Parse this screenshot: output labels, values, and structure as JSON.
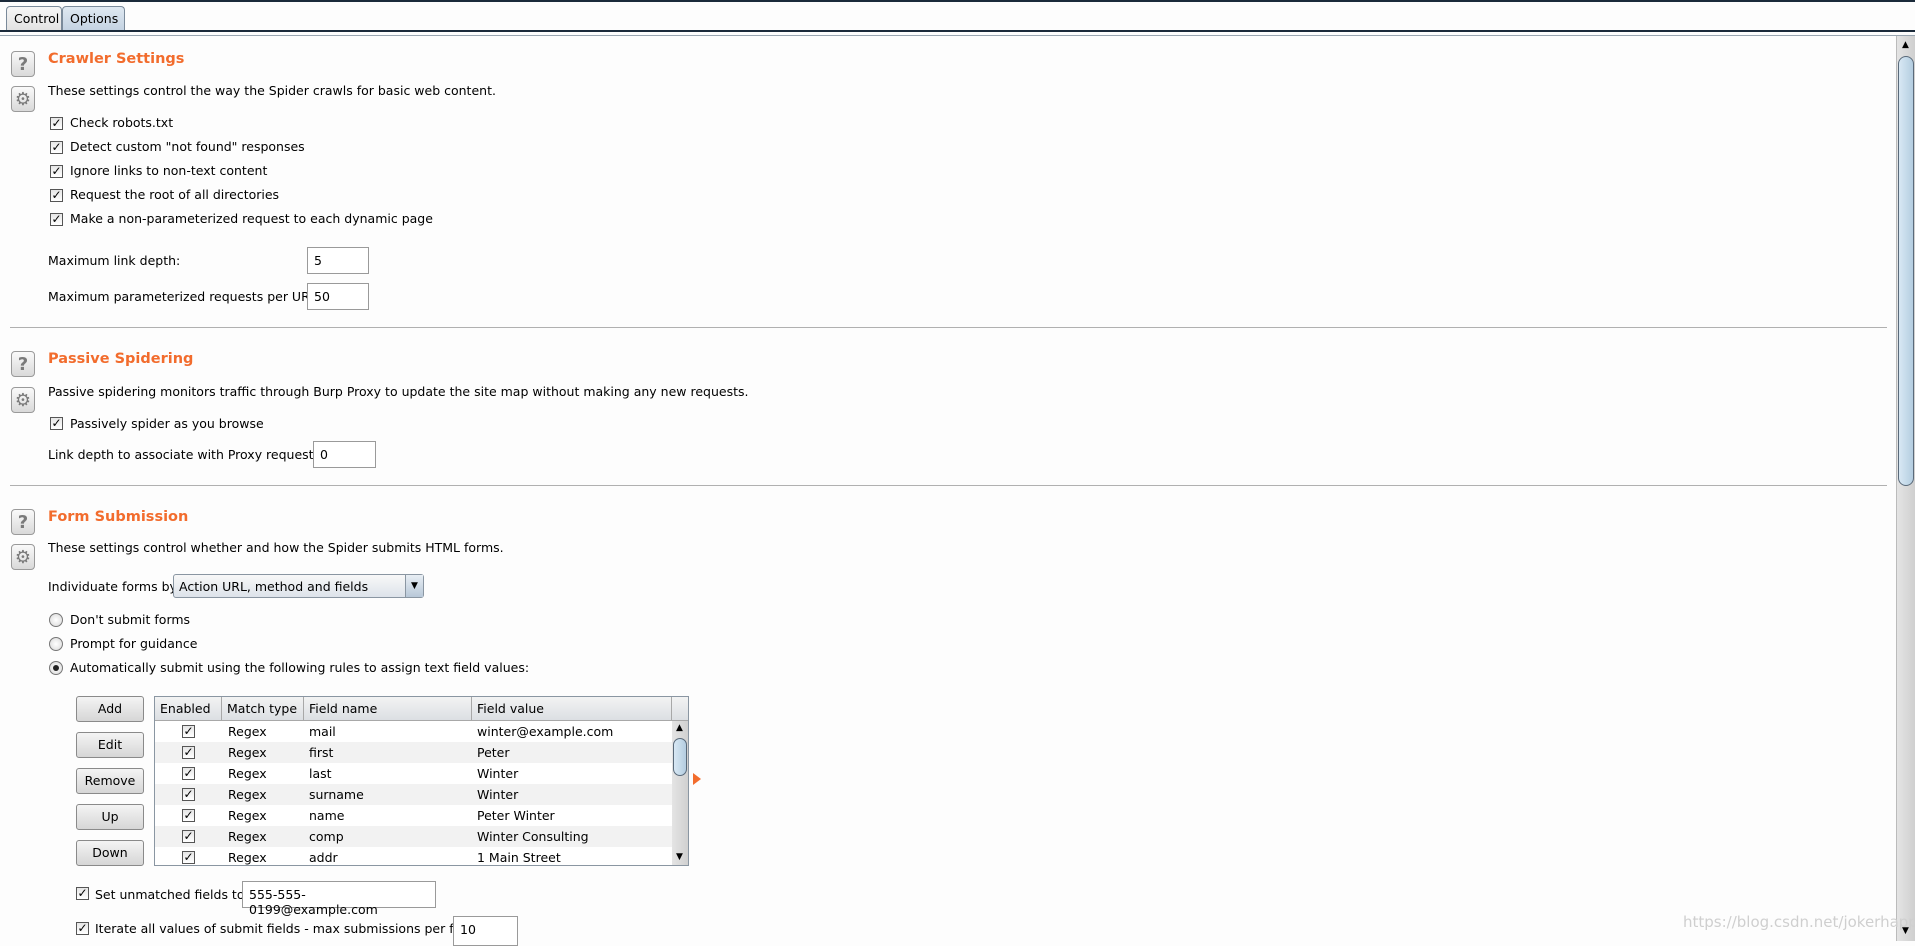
{
  "tabs": [
    {
      "label": "Control",
      "active": false
    },
    {
      "label": "Options",
      "active": true
    }
  ],
  "crawler": {
    "title": "Crawler Settings",
    "description": "These settings control the way the Spider crawls for basic web content.",
    "checkboxes": [
      {
        "label": "Check robots.txt",
        "checked": true
      },
      {
        "label": "Detect custom \"not found\" responses",
        "checked": true
      },
      {
        "label": "Ignore links to non-text content",
        "checked": true
      },
      {
        "label": "Request the root of all directories",
        "checked": true
      },
      {
        "label": "Make a non-parameterized request to each dynamic page",
        "checked": true
      }
    ],
    "max_depth_label": "Maximum link depth:",
    "max_depth_value": "5",
    "max_param_label": "Maximum parameterized requests per URL:",
    "max_param_value": "50"
  },
  "passive": {
    "title": "Passive Spidering",
    "description": "Passive spidering monitors traffic through Burp Proxy to update the site map without making any new requests.",
    "checkbox_label": "Passively spider as you browse",
    "checked": true,
    "link_depth_label": "Link depth to associate with Proxy requests:",
    "link_depth_value": "0"
  },
  "form": {
    "title": "Form Submission",
    "description": "These settings control whether and how the Spider submits HTML forms.",
    "individuate_label": "Individuate forms by:",
    "individuate_value": "Action URL, method and fields",
    "radios": [
      {
        "label": "Don't submit forms",
        "selected": false
      },
      {
        "label": "Prompt for guidance",
        "selected": false
      },
      {
        "label": "Automatically submit using the following rules to assign text field values:",
        "selected": true
      }
    ],
    "buttons": [
      "Add",
      "Edit",
      "Remove",
      "Up",
      "Down"
    ],
    "columns": [
      "Enabled",
      "Match type",
      "Field name",
      "Field value"
    ],
    "rows": [
      {
        "enabled": true,
        "match": "Regex",
        "name": "mail",
        "value": "winter@example.com"
      },
      {
        "enabled": true,
        "match": "Regex",
        "name": "first",
        "value": "Peter"
      },
      {
        "enabled": true,
        "match": "Regex",
        "name": "last",
        "value": "Winter"
      },
      {
        "enabled": true,
        "match": "Regex",
        "name": "surname",
        "value": "Winter"
      },
      {
        "enabled": true,
        "match": "Regex",
        "name": "name",
        "value": "Peter Winter"
      },
      {
        "enabled": true,
        "match": "Regex",
        "name": "comp",
        "value": "Winter Consulting"
      },
      {
        "enabled": true,
        "match": "Regex",
        "name": "addr",
        "value": "1 Main Street"
      }
    ],
    "unmatched_label": "Set unmatched fields to:",
    "unmatched_checked": true,
    "unmatched_value": "555-555-0199@example.com",
    "iterate_label": "Iterate all values of submit fields - max submissions per form:",
    "iterate_checked": true,
    "iterate_value": "10"
  },
  "watermark": "https://blog.csdn.net/jokerhappy",
  "colors": {
    "title": "#f26c2d",
    "arrow": "#f26c2d"
  }
}
